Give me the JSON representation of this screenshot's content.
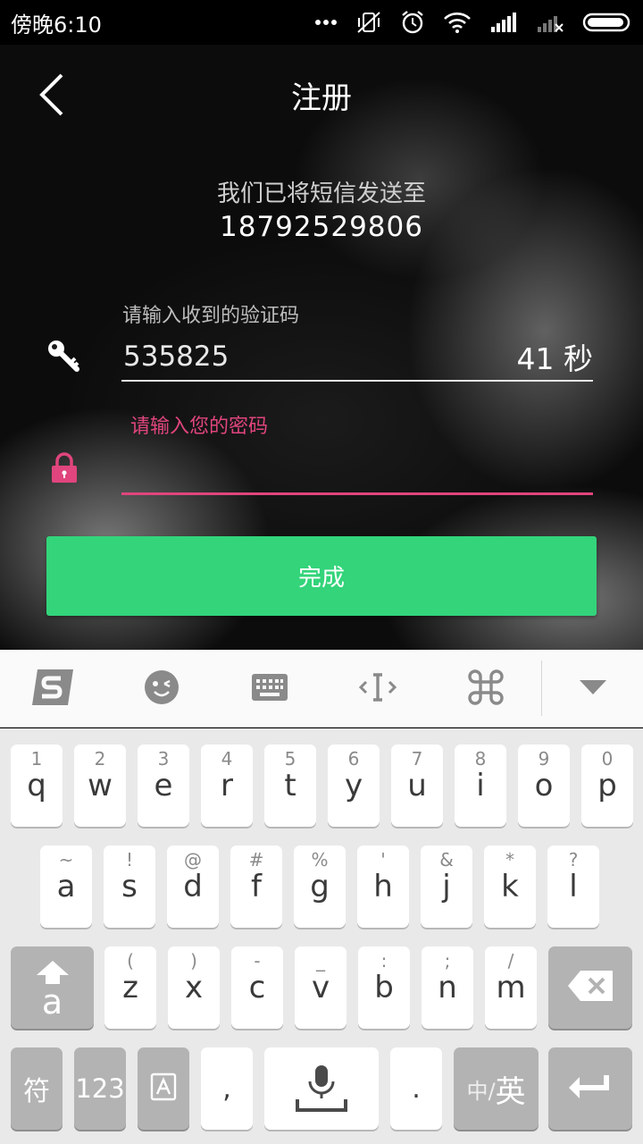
{
  "status_bar": {
    "time": "傍晚6:10",
    "icons": [
      "more-dots-icon",
      "vibrate-off-icon",
      "alarm-icon",
      "wifi-icon",
      "signal-icon",
      "signal-no-sim-icon",
      "battery-icon"
    ]
  },
  "header": {
    "back_icon": "chevron-left-icon",
    "title": "注册"
  },
  "message": {
    "sent_to": "我们已将短信发送至",
    "phone": "18792529806"
  },
  "code_field": {
    "label": "请输入收到的验证码",
    "value": "535825",
    "countdown": "41 秒",
    "icon": "key-icon"
  },
  "password_field": {
    "placeholder": "请输入您的密码",
    "value": "",
    "icon": "lock-icon"
  },
  "submit": {
    "label": "完成"
  },
  "colors": {
    "accent_pink": "#e0457d",
    "button_green": "#33d47a",
    "sogou_orange": "#8a8a8a"
  },
  "keyboard": {
    "toolbar": [
      "sogou-logo-icon",
      "emoji-icon",
      "keyboard-icon",
      "cursor-move-icon",
      "command-icon",
      "collapse-arrow-icon"
    ],
    "row1": [
      {
        "sub": "1",
        "main": "q"
      },
      {
        "sub": "2",
        "main": "w"
      },
      {
        "sub": "3",
        "main": "e"
      },
      {
        "sub": "4",
        "main": "r"
      },
      {
        "sub": "5",
        "main": "t"
      },
      {
        "sub": "6",
        "main": "y"
      },
      {
        "sub": "7",
        "main": "u"
      },
      {
        "sub": "8",
        "main": "i"
      },
      {
        "sub": "9",
        "main": "o"
      },
      {
        "sub": "0",
        "main": "p"
      }
    ],
    "row2": [
      {
        "sub": "~",
        "main": "a"
      },
      {
        "sub": "!",
        "main": "s"
      },
      {
        "sub": "@",
        "main": "d"
      },
      {
        "sub": "#",
        "main": "f"
      },
      {
        "sub": "%",
        "main": "g"
      },
      {
        "sub": "'",
        "main": "h"
      },
      {
        "sub": "&",
        "main": "j"
      },
      {
        "sub": "*",
        "main": "k"
      },
      {
        "sub": "?",
        "main": "l"
      }
    ],
    "row3": [
      {
        "sub": "(",
        "main": "z"
      },
      {
        "sub": ")",
        "main": "x"
      },
      {
        "sub": "-",
        "main": "c"
      },
      {
        "sub": "_",
        "main": "v"
      },
      {
        "sub": ":",
        "main": "b"
      },
      {
        "sub": ";",
        "main": "n"
      },
      {
        "sub": "/",
        "main": "m"
      }
    ],
    "shift_letter": "a",
    "bottom": {
      "symbol": "符",
      "numbers": "123",
      "comma": ",",
      "period": ".",
      "lang_small": "中/",
      "lang_big": "英"
    }
  }
}
